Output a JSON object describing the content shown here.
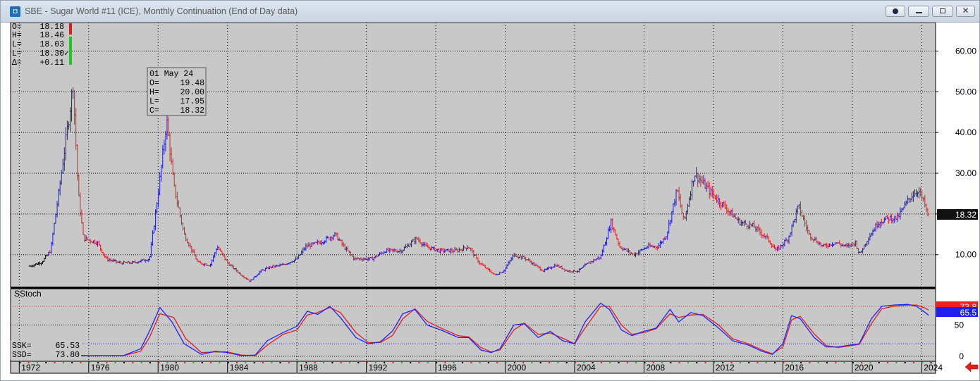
{
  "window": {
    "title": "SBE - Sugar World #11 (ICE), Monthly Continuation (End of Day data)",
    "icon": "app-logo-icon",
    "buttons": [
      "circle-icon",
      "minimize-icon",
      "maximize-icon",
      "close-icon"
    ]
  },
  "ohlc_panel": {
    "rows": [
      {
        "label": "O=",
        "value": "18.18"
      },
      {
        "label": "H=",
        "value": "18.46"
      },
      {
        "label": "L=",
        "value": "18.03"
      },
      {
        "label": "L=",
        "value": "18.30"
      },
      {
        "label": "Δ=",
        "value": "+0.11"
      }
    ],
    "check_mark": "✓"
  },
  "tooltip": {
    "date": "01 May 24",
    "rows": [
      {
        "label": "O=",
        "value": "19.48"
      },
      {
        "label": "H=",
        "value": "20.00"
      },
      {
        "label": "L=",
        "value": "17.95"
      },
      {
        "label": "C=",
        "value": "18.32"
      }
    ]
  },
  "indicator": {
    "name": "SStoch",
    "ssk_label": "SSK=",
    "ssk_value": "65.53",
    "ssd_label": "SSD=",
    "ssd_value": "73.80",
    "red_tag": "73.8",
    "blue_tag": "65.5"
  },
  "price_tag": "18.32",
  "nav_icon": "red-left-arrow-icon",
  "colors": {
    "up": "#1c1ccc",
    "down": "#e02020",
    "ssk": "#2222ff",
    "ssd": "#e02020",
    "background": "#c8c8c8",
    "price_tag_bg": "#111111"
  },
  "chart_data": [
    {
      "type": "ohlc_bars",
      "x_axis": {
        "unit": "year",
        "range": [
          1971.5,
          2024.8
        ],
        "ticks": [
          "1972",
          "1976",
          "1980",
          "1984",
          "1988",
          "1992",
          "1996",
          "2000",
          "2004",
          "2008",
          "2012",
          "2016",
          "2020",
          "2024"
        ]
      },
      "y_axis": {
        "range": [
          2,
          67
        ],
        "ticks": [
          "10.00",
          "20.00",
          "30.00",
          "40.00",
          "50.00",
          "60.00"
        ],
        "side": "right"
      },
      "grid": true,
      "approx_price_path": [
        [
          1972.6,
          7.2
        ],
        [
          1973.3,
          8.2
        ],
        [
          1973.8,
          11
        ],
        [
          1974.3,
          26
        ],
        [
          1974.9,
          45
        ],
        [
          1975.1,
          52
        ],
        [
          1975.4,
          25
        ],
        [
          1975.7,
          14
        ],
        [
          1976.5,
          13
        ],
        [
          1977.0,
          9
        ],
        [
          1977.8,
          8
        ],
        [
          1978.5,
          8
        ],
        [
          1979.5,
          9
        ],
        [
          1980.0,
          25
        ],
        [
          1980.5,
          43
        ],
        [
          1980.9,
          27
        ],
        [
          1981.5,
          15
        ],
        [
          1982.3,
          8
        ],
        [
          1983.0,
          7.5
        ],
        [
          1983.4,
          12
        ],
        [
          1984.0,
          8
        ],
        [
          1984.8,
          5
        ],
        [
          1985.3,
          3.5
        ],
        [
          1985.9,
          6
        ],
        [
          1986.5,
          7
        ],
        [
          1987.2,
          7.5
        ],
        [
          1988.0,
          9
        ],
        [
          1988.5,
          12
        ],
        [
          1989.3,
          13
        ],
        [
          1990.2,
          15
        ],
        [
          1990.7,
          12
        ],
        [
          1991.3,
          9
        ],
        [
          1992.3,
          9
        ],
        [
          1993.1,
          11
        ],
        [
          1994.0,
          11
        ],
        [
          1994.9,
          14
        ],
        [
          1995.4,
          12
        ],
        [
          1996.2,
          11
        ],
        [
          1997.2,
          11
        ],
        [
          1997.9,
          12
        ],
        [
          1998.5,
          8
        ],
        [
          1999.4,
          5
        ],
        [
          1999.9,
          6
        ],
        [
          2000.5,
          10
        ],
        [
          2001.2,
          9
        ],
        [
          2002.2,
          6
        ],
        [
          2002.9,
          7.5
        ],
        [
          2003.6,
          6
        ],
        [
          2004.2,
          6
        ],
        [
          2004.8,
          8
        ],
        [
          2005.5,
          9.5
        ],
        [
          2006.1,
          18
        ],
        [
          2006.6,
          12
        ],
        [
          2007.4,
          10
        ],
        [
          2008.2,
          12
        ],
        [
          2008.8,
          12
        ],
        [
          2009.3,
          15
        ],
        [
          2009.9,
          26
        ],
        [
          2010.3,
          18
        ],
        [
          2010.9,
          30
        ],
        [
          2011.3,
          28
        ],
        [
          2011.9,
          25
        ],
        [
          2012.6,
          22
        ],
        [
          2013.5,
          18
        ],
        [
          2014.3,
          17
        ],
        [
          2015.1,
          14
        ],
        [
          2015.6,
          11
        ],
        [
          2016.3,
          14
        ],
        [
          2016.9,
          22
        ],
        [
          2017.5,
          15
        ],
        [
          2018.3,
          12
        ],
        [
          2019.0,
          13
        ],
        [
          2019.7,
          12
        ],
        [
          2020.2,
          13
        ],
        [
          2020.4,
          10
        ],
        [
          2020.9,
          14
        ],
        [
          2021.5,
          18
        ],
        [
          2022.1,
          19
        ],
        [
          2022.6,
          19
        ],
        [
          2023.3,
          24
        ],
        [
          2023.8,
          26
        ],
        [
          2024.2,
          22
        ],
        [
          2024.4,
          18.32
        ]
      ]
    },
    {
      "type": "line",
      "name": "SStoch",
      "y_axis": {
        "ticks": [
          "0",
          "50"
        ],
        "reference_levels": [
          80,
          20
        ]
      },
      "series": [
        {
          "name": "SSK",
          "color": "#2222ff",
          "points": [
            [
              1975.0,
              2
            ],
            [
              1976.0,
              1
            ],
            [
              1978.0,
              1
            ],
            [
              1979.0,
              12
            ],
            [
              1979.5,
              40
            ],
            [
              1980.1,
              78
            ],
            [
              1980.8,
              55
            ],
            [
              1981.5,
              20
            ],
            [
              1982.5,
              3
            ],
            [
              1983.3,
              8
            ],
            [
              1984.0,
              6
            ],
            [
              1984.8,
              1
            ],
            [
              1985.6,
              2
            ],
            [
              1986.3,
              25
            ],
            [
              1987.2,
              38
            ],
            [
              1988.0,
              48
            ],
            [
              1988.6,
              72
            ],
            [
              1989.2,
              67
            ],
            [
              1989.9,
              80
            ],
            [
              1990.5,
              62
            ],
            [
              1991.4,
              30
            ],
            [
              1992.1,
              20
            ],
            [
              1992.8,
              23
            ],
            [
              1993.5,
              40
            ],
            [
              1994.1,
              68
            ],
            [
              1994.8,
              75
            ],
            [
              1995.5,
              50
            ],
            [
              1996.3,
              42
            ],
            [
              1997.3,
              30
            ],
            [
              1997.9,
              30
            ],
            [
              1998.6,
              10
            ],
            [
              1999.2,
              6
            ],
            [
              1999.7,
              12
            ],
            [
              2000.5,
              50
            ],
            [
              2001.1,
              52
            ],
            [
              2001.9,
              30
            ],
            [
              2002.6,
              40
            ],
            [
              2003.3,
              25
            ],
            [
              2004.0,
              20
            ],
            [
              2004.6,
              55
            ],
            [
              2005.5,
              85
            ],
            [
              2006.0,
              75
            ],
            [
              2006.7,
              42
            ],
            [
              2007.3,
              33
            ],
            [
              2008.0,
              40
            ],
            [
              2008.7,
              45
            ],
            [
              2009.5,
              75
            ],
            [
              2010.0,
              55
            ],
            [
              2010.7,
              70
            ],
            [
              2011.4,
              65
            ],
            [
              2012.3,
              45
            ],
            [
              2013.1,
              25
            ],
            [
              2014.0,
              18
            ],
            [
              2014.8,
              8
            ],
            [
              2015.4,
              3
            ],
            [
              2016.0,
              20
            ],
            [
              2016.5,
              65
            ],
            [
              2017.0,
              60
            ],
            [
              2017.8,
              30
            ],
            [
              2018.5,
              15
            ],
            [
              2019.2,
              15
            ],
            [
              2019.9,
              18
            ],
            [
              2020.4,
              20
            ],
            [
              2021.1,
              60
            ],
            [
              2021.7,
              80
            ],
            [
              2022.4,
              82
            ],
            [
              2023.2,
              83
            ],
            [
              2023.7,
              80
            ],
            [
              2024.2,
              70
            ],
            [
              2024.4,
              65.53
            ]
          ]
        },
        {
          "name": "SSD",
          "color": "#e02020",
          "points": [
            [
              1975.0,
              2
            ],
            [
              1976.0,
              1
            ],
            [
              1978.0,
              1
            ],
            [
              1979.0,
              8
            ],
            [
              1979.5,
              30
            ],
            [
              1980.1,
              68
            ],
            [
              1980.9,
              62
            ],
            [
              1981.6,
              28
            ],
            [
              1982.5,
              6
            ],
            [
              1983.3,
              7
            ],
            [
              1984.0,
              7
            ],
            [
              1984.8,
              2
            ],
            [
              1985.6,
              1
            ],
            [
              1986.3,
              18
            ],
            [
              1987.2,
              35
            ],
            [
              1988.0,
              42
            ],
            [
              1988.6,
              66
            ],
            [
              1989.2,
              70
            ],
            [
              1989.9,
              78
            ],
            [
              1990.5,
              70
            ],
            [
              1991.4,
              38
            ],
            [
              1992.1,
              22
            ],
            [
              1992.8,
              22
            ],
            [
              1993.5,
              33
            ],
            [
              1994.1,
              60
            ],
            [
              1994.8,
              76
            ],
            [
              1995.5,
              56
            ],
            [
              1996.3,
              45
            ],
            [
              1997.3,
              33
            ],
            [
              1997.9,
              31
            ],
            [
              1998.6,
              14
            ],
            [
              1999.2,
              7
            ],
            [
              1999.7,
              10
            ],
            [
              2000.5,
              42
            ],
            [
              2001.1,
              53
            ],
            [
              2001.9,
              35
            ],
            [
              2002.6,
              37
            ],
            [
              2003.3,
              29
            ],
            [
              2004.0,
              20
            ],
            [
              2004.6,
              45
            ],
            [
              2005.5,
              80
            ],
            [
              2006.0,
              80
            ],
            [
              2006.7,
              50
            ],
            [
              2007.3,
              35
            ],
            [
              2008.0,
              38
            ],
            [
              2008.7,
              44
            ],
            [
              2009.5,
              68
            ],
            [
              2010.0,
              62
            ],
            [
              2010.7,
              66
            ],
            [
              2011.4,
              67
            ],
            [
              2012.3,
              50
            ],
            [
              2013.1,
              28
            ],
            [
              2014.0,
              20
            ],
            [
              2014.8,
              10
            ],
            [
              2015.4,
              4
            ],
            [
              2016.0,
              15
            ],
            [
              2016.5,
              58
            ],
            [
              2017.0,
              64
            ],
            [
              2017.8,
              36
            ],
            [
              2018.5,
              17
            ],
            [
              2019.2,
              14
            ],
            [
              2019.9,
              17
            ],
            [
              2020.4,
              19
            ],
            [
              2021.1,
              52
            ],
            [
              2021.7,
              76
            ],
            [
              2022.4,
              80
            ],
            [
              2023.2,
              82
            ],
            [
              2023.7,
              82
            ],
            [
              2024.2,
              77
            ],
            [
              2024.4,
              73.8
            ]
          ]
        }
      ]
    }
  ]
}
